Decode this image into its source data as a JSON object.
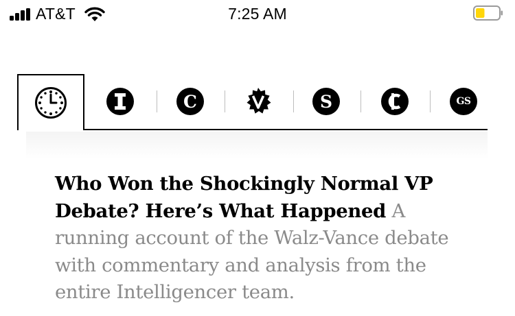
{
  "status_bar": {
    "carrier": "AT&T",
    "time": "7:25 AM",
    "battery_level": 0.15,
    "battery_color": "#ffd60a"
  },
  "tabs": [
    {
      "name": "clock",
      "icon": "clock-icon",
      "active": true
    },
    {
      "name": "intelligencer",
      "icon": "I",
      "active": false
    },
    {
      "name": "curbed",
      "icon": "C",
      "active": false
    },
    {
      "name": "vulture",
      "icon": "V",
      "active": false
    },
    {
      "name": "strategist",
      "icon": "S",
      "active": false
    },
    {
      "name": "cut",
      "icon": "C",
      "active": false
    },
    {
      "name": "grub-street",
      "icon": "GS",
      "active": false
    }
  ],
  "article": {
    "headline": "Who Won the Shockingly Normal VP Debate? Here’s What Happened",
    "dek": "A running account of the Walz-Vance debate with commentary and analysis from the entire Intelligencer team."
  }
}
